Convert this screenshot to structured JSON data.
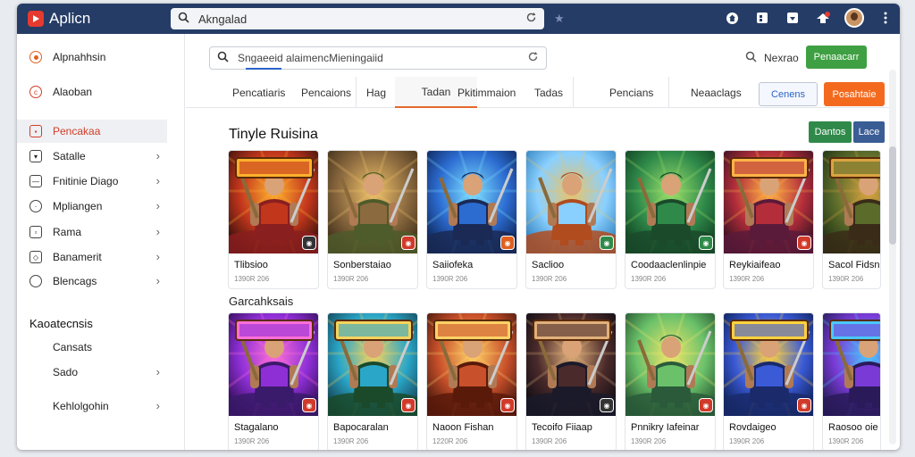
{
  "topbar": {
    "app_name": "Aplicn",
    "address": "Akngalad",
    "icons": [
      "home-icon",
      "grid-icon",
      "download-icon",
      "notifications-icon"
    ]
  },
  "sidebar": {
    "items": [
      {
        "label": "Alpnahhsin",
        "icon": "home-icon"
      },
      {
        "label": "Alaoban",
        "icon": "compass-icon"
      },
      {
        "label": "Pencakaa",
        "icon": "games-icon",
        "active": true
      },
      {
        "label": "Satalle",
        "icon": "chat-icon"
      },
      {
        "label": "Fnitinie Diago",
        "icon": "file-icon"
      },
      {
        "label": "Mpliangen",
        "icon": "settings-icon"
      },
      {
        "label": "Rama",
        "icon": "bag-icon"
      },
      {
        "label": "Banamerit",
        "icon": "bookmark-icon"
      },
      {
        "label": "Blencags",
        "icon": "circle-icon"
      }
    ],
    "section_heading": "Kaoatecnsis",
    "sub_items": [
      "Cansats",
      "Sado",
      "Kehlolgohin"
    ]
  },
  "main": {
    "search_value": "Sngaeeid alaimencMieningaiid",
    "reviews_label": "Nexrao",
    "green_button": "Penaacarr",
    "tabs": [
      "Pencatiaris",
      "Pencaions",
      "Hag",
      "Tadan",
      "Pkitimmaion",
      "Tadas",
      "Pencians",
      "Neaaclags"
    ],
    "outline_button": "Cenens",
    "orange_button": "Posahtaie",
    "section_title": "Tinyle Ruisina",
    "mini_buttons": [
      "Dantos",
      "Lace"
    ],
    "section_title2": "Garcahksais",
    "row1": [
      {
        "title": "Tlibsioo",
        "meta": "1390R 206",
        "badge": "#333333"
      },
      {
        "title": "Sonberstaiao",
        "meta": "1390R 206",
        "badge": "#d13a2a"
      },
      {
        "title": "Saiiofeka",
        "meta": "1390R 206",
        "badge": "#e06020"
      },
      {
        "title": "Saclioo",
        "meta": "1390R 206",
        "badge": "#2f8a4a"
      },
      {
        "title": "Coodaaclenlinpie",
        "meta": "1390R 206",
        "badge": "#2f8a4a"
      },
      {
        "title": "Reykiaifeao",
        "meta": "1390R 206",
        "badge": "#d13a2a"
      },
      {
        "title": "Sacol Fidsna",
        "meta": "1390R 206",
        "badge": "#d13a2a"
      }
    ],
    "row2": [
      {
        "title": "Stagalano",
        "meta": "1390R 206",
        "badge": "#d13a2a"
      },
      {
        "title": "Bapocaralan",
        "meta": "1390R 206",
        "badge": "#d13a2a"
      },
      {
        "title": "Naoon Fishan",
        "meta": "1220R 206",
        "badge": "#d13a2a"
      },
      {
        "title": "Tecoifo Fiiaap",
        "meta": "1390R 206",
        "badge": "#333333"
      },
      {
        "title": "Pnnikry Iafeinar",
        "meta": "1390R 206",
        "badge": "#d13a2a"
      },
      {
        "title": "Rovdaigeo",
        "meta": "1390R 206",
        "badge": "#d13a2a"
      },
      {
        "title": "Raosoo oie",
        "meta": "1390R 206",
        "badge": "#d13a2a"
      }
    ]
  }
}
